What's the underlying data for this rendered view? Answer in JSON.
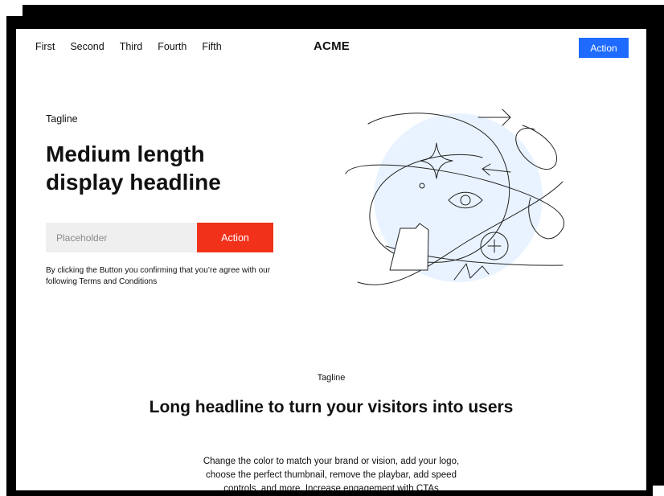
{
  "nav": {
    "links": [
      "First",
      "Second",
      "Third",
      "Fourth",
      "Fifth"
    ],
    "logo": "ACME",
    "action_label": "Action"
  },
  "hero": {
    "tagline": "Tagline",
    "headline": "Medium length display headline",
    "input_placeholder": "Placeholder",
    "action_label": "Action",
    "terms": "By clicking the Button you confirming that you’re agree with our following Terms and Conditions"
  },
  "section": {
    "tagline": "Tagline",
    "headline": "Long headline to turn your visitors into users",
    "body": "Change the color to match your brand or vision, add your logo, choose the perfect thumbnail, remove the playbar, add speed controls, and more. Increase engagement with CTAs"
  },
  "colors": {
    "primary": "#1f6bff",
    "accent": "#f2311a",
    "illustration_bg": "#e9f3ff"
  },
  "icons": [
    "sparkle-icon",
    "eye-icon",
    "plus-circle-icon",
    "arrow-right-icon",
    "document-icon"
  ]
}
